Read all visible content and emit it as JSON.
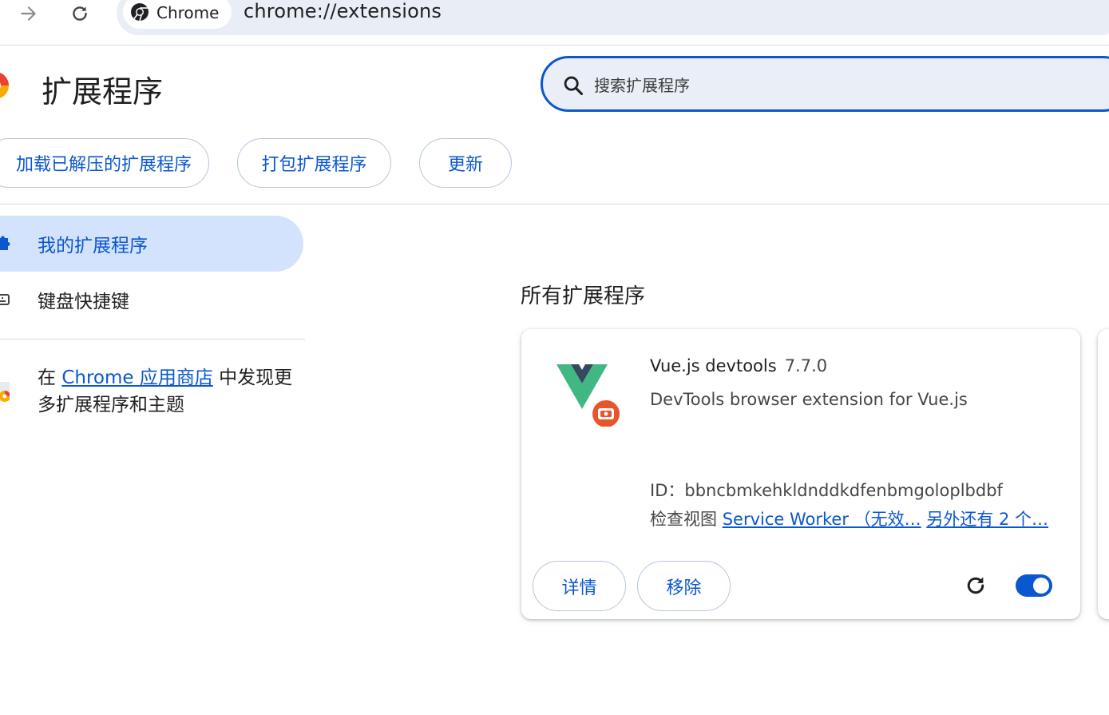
{
  "toolbar": {
    "chip_label": "Chrome",
    "url": "chrome://extensions"
  },
  "header": {
    "title": "扩展程序",
    "search_placeholder": "搜索扩展程序"
  },
  "actions": {
    "load_unpacked": "加载已解压的扩展程序",
    "pack": "打包扩展程序",
    "update": "更新"
  },
  "sidebar": {
    "items": [
      {
        "label": "我的扩展程序",
        "active": true
      },
      {
        "label": "键盘快捷键",
        "active": false
      }
    ],
    "store_prefix": "在 ",
    "store_link": "Chrome 应用商店",
    "store_suffix": " 中发现更多扩展程序和主题"
  },
  "main": {
    "section_title": "所有扩展程序",
    "extension": {
      "name": "Vue.js devtools",
      "version": "7.7.0",
      "description": "DevTools browser extension for Vue.js",
      "id_text": "ID：bbncbmkehkldnddkdfenbmgoloplbdbf",
      "inspect_label": "检查视图 ",
      "inspect_link_1": "Service Worker （无效…",
      "inspect_link_2": "另外还有 2 个…",
      "details_label": "详情",
      "remove_label": "移除",
      "enabled": true
    }
  },
  "colors": {
    "accent": "#0b57d0",
    "vue_green": "#41b883",
    "vue_dark": "#35495e",
    "badge_orange": "#e8552d"
  }
}
